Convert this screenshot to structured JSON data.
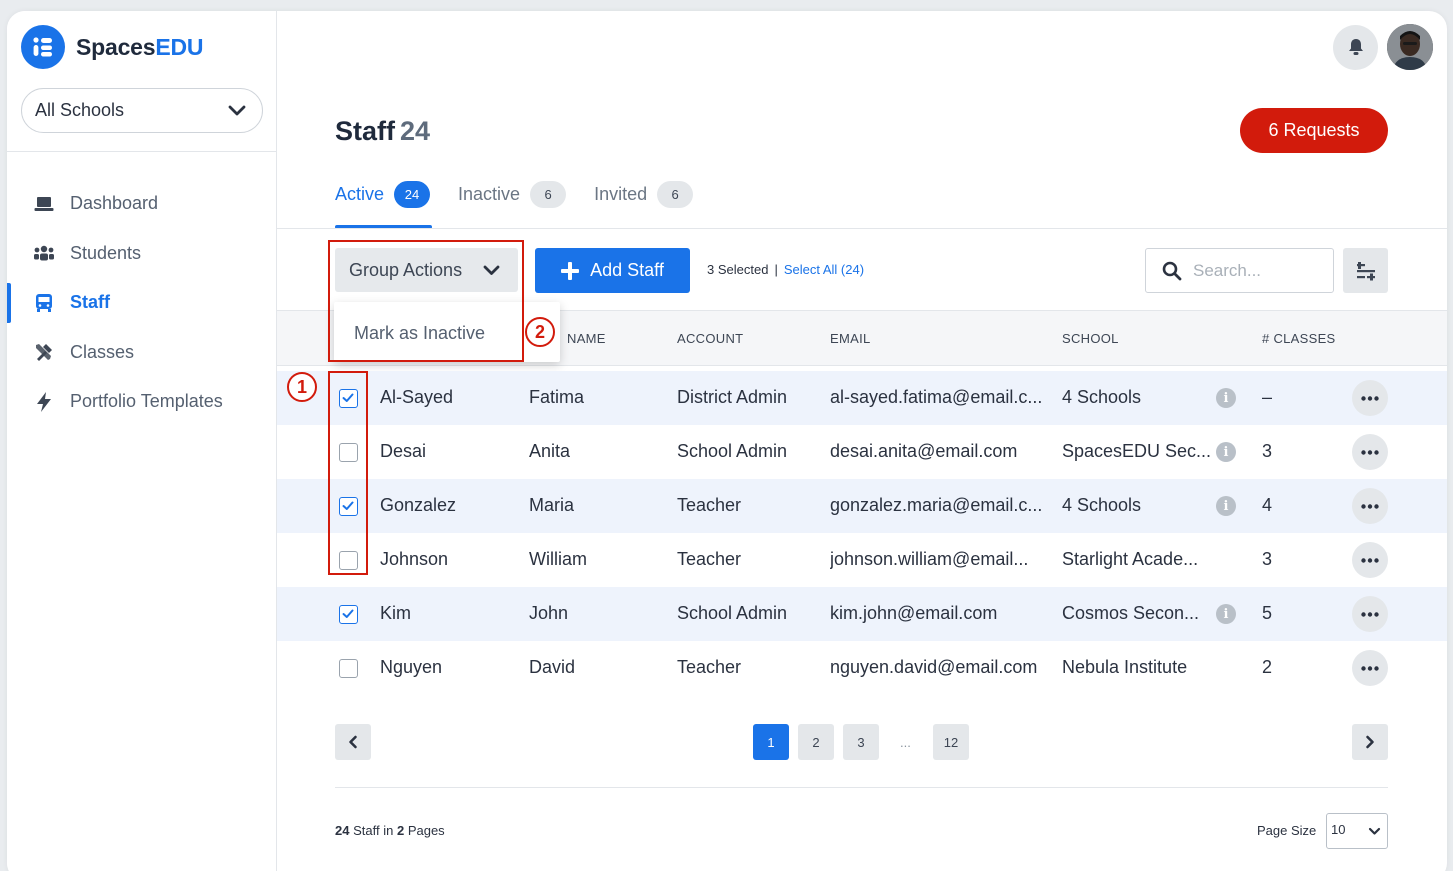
{
  "brand": {
    "name_part1": "Spaces",
    "name_part2": "EDU",
    "color": "#1a73e8"
  },
  "sidebar": {
    "school_select": "All Schools",
    "items": [
      {
        "label": "Dashboard",
        "icon": "laptop-icon",
        "active": false
      },
      {
        "label": "Students",
        "icon": "users-icon",
        "active": false
      },
      {
        "label": "Staff",
        "icon": "bus-icon",
        "active": true
      },
      {
        "label": "Classes",
        "icon": "tools-icon",
        "active": false
      },
      {
        "label": "Portfolio Templates",
        "icon": "bolt-icon",
        "active": false
      }
    ]
  },
  "header": {
    "title": "Staff",
    "title_count": "24",
    "requests_button": "6 Requests",
    "requests_color": "#d21b0c"
  },
  "tabs": [
    {
      "label": "Active",
      "count": "24",
      "active": true
    },
    {
      "label": "Inactive",
      "count": "6",
      "active": false
    },
    {
      "label": "Invited",
      "count": "6",
      "active": false
    }
  ],
  "toolbar": {
    "group_actions": "Group Actions",
    "add_staff": "Add Staff",
    "selected_text": "3 Selected",
    "separator": "|",
    "select_all": "Select All (24)",
    "search_placeholder": "Search..."
  },
  "dropdown": {
    "item": "Mark as Inactive"
  },
  "table": {
    "headers": {
      "first_name": "NAME",
      "account": "ACCOUNT",
      "email": "EMAIL",
      "school": "SCHOOL",
      "classes": "# CLASSES"
    },
    "rows": [
      {
        "last": "Al-Sayed",
        "first": "Fatima",
        "account": "District Admin",
        "email": "al-sayed.fatima@email.c...",
        "school": "4 Schools",
        "info": true,
        "classes": "–",
        "checked": true
      },
      {
        "last": "Desai",
        "first": "Anita",
        "account": "School Admin",
        "email": "desai.anita@email.com",
        "school": "SpacesEDU Sec...",
        "info": true,
        "classes": "3",
        "checked": false
      },
      {
        "last": "Gonzalez",
        "first": "Maria",
        "account": "Teacher",
        "email": "gonzalez.maria@email.c...",
        "school": "4 Schools",
        "info": true,
        "classes": "4",
        "checked": true
      },
      {
        "last": "Johnson",
        "first": "William",
        "account": "Teacher",
        "email": "johnson.william@email...",
        "school": "Starlight Acade...",
        "info": false,
        "classes": "3",
        "checked": false
      },
      {
        "last": "Kim",
        "first": "John",
        "account": "School Admin",
        "email": "kim.john@email.com",
        "school": "Cosmos Secon...",
        "info": true,
        "classes": "5",
        "checked": true
      },
      {
        "last": "Nguyen",
        "first": "David",
        "account": "Teacher",
        "email": "nguyen.david@email.com",
        "school": "Nebula Institute",
        "info": false,
        "classes": "2",
        "checked": false
      }
    ]
  },
  "pagination": {
    "pages": [
      "1",
      "2",
      "3"
    ],
    "ellipsis": "...",
    "last_page": "12",
    "current": "1"
  },
  "footer": {
    "count": "24",
    "staff_in": "Staff in",
    "pages": "2",
    "pages_label": "Pages",
    "page_size_label": "Page Size",
    "page_size_value": "10"
  },
  "annotations": {
    "one": "1",
    "two": "2",
    "color": "#d21b0c"
  }
}
